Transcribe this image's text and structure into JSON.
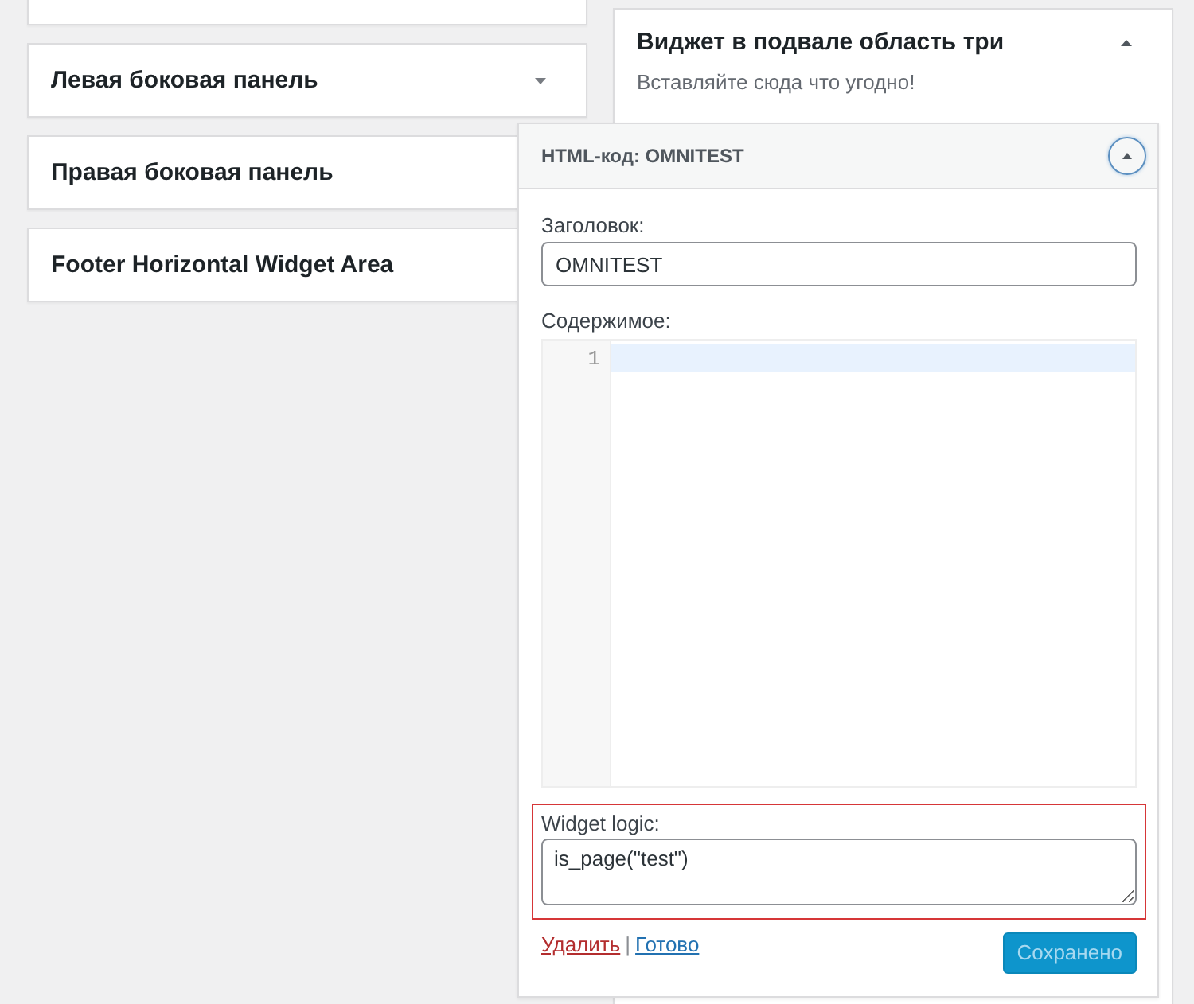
{
  "sidebars": [
    {
      "title": "Левая боковая панель",
      "expanded": false
    },
    {
      "title": "Правая боковая панель",
      "expanded": false
    },
    {
      "title": "Footer Horizontal Widget Area",
      "expanded": false
    }
  ],
  "open_sidebar": {
    "title": "Виджет в подвале область три",
    "description": "Вставляйте сюда что угодно!",
    "expanded": true
  },
  "widget": {
    "title": "**HTML-код:** OMNITEST",
    "expanded": true,
    "fields": [
      {
        "kind": "text",
        "label": "Заголовок:",
        "value": "OMNITEST"
      },
      {
        "kind": "code",
        "label": "Содержимое:",
        "line_numbers": [
          "1"
        ]
      }
    ],
    "logic": {
      "label": "Widget logic:",
      "value": "is_page(\"test\")",
      "highlighted": true
    },
    "links": [
      {
        "kind": "delete",
        "text": "Удалить"
      },
      {
        "kind": "done",
        "text": "Готово"
      }
    ],
    "separator": "|",
    "save_button": {
      "label": "Сохранено",
      "disabled": true
    }
  }
}
